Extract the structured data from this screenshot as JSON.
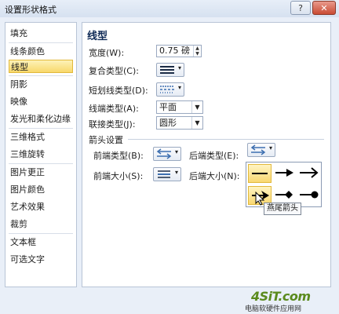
{
  "window": {
    "title": "设置形状格式",
    "help_label": "?",
    "close_label": "✕"
  },
  "sidebar": {
    "items": [
      {
        "label": "填充"
      },
      {
        "label": "线条颜色"
      },
      {
        "label": "线型",
        "selected": true
      },
      {
        "label": "阴影"
      },
      {
        "label": "映像"
      },
      {
        "label": "发光和柔化边缘"
      },
      {
        "label": "三维格式"
      },
      {
        "label": "三维旋转"
      },
      {
        "label": "图片更正"
      },
      {
        "label": "图片颜色"
      },
      {
        "label": "艺术效果"
      },
      {
        "label": "裁剪"
      },
      {
        "label": "文本框"
      },
      {
        "label": "可选文字"
      }
    ]
  },
  "panel": {
    "title": "线型",
    "width_label": "宽度(W):",
    "width_value": "0.75 磅",
    "compound_label": "复合类型(C):",
    "dash_label": "短划线类型(D):",
    "cap_label": "线端类型(A):",
    "cap_value": "平面",
    "join_label": "联接类型(J):",
    "join_value": "圆形",
    "arrow_settings_label": "箭头设置",
    "begin_type_label": "前端类型(B):",
    "end_type_label": "后端类型(E):",
    "begin_size_label": "前端大小(S):",
    "end_size_label": "后端大小(N):"
  },
  "arrow_popup": {
    "options": [
      "line",
      "arrow",
      "open-arrow",
      "stealth-arrow",
      "diamond-arrow",
      "oval-arrow"
    ],
    "highlighted": "stealth-arrow",
    "tooltip": "燕尾箭头"
  },
  "watermark": {
    "logo": "4SiT.com",
    "text": "电脑软硬件应用网"
  },
  "colors": {
    "accent": "#f8d86b",
    "title": "#0f2a56",
    "frame": "#e9eff8"
  }
}
